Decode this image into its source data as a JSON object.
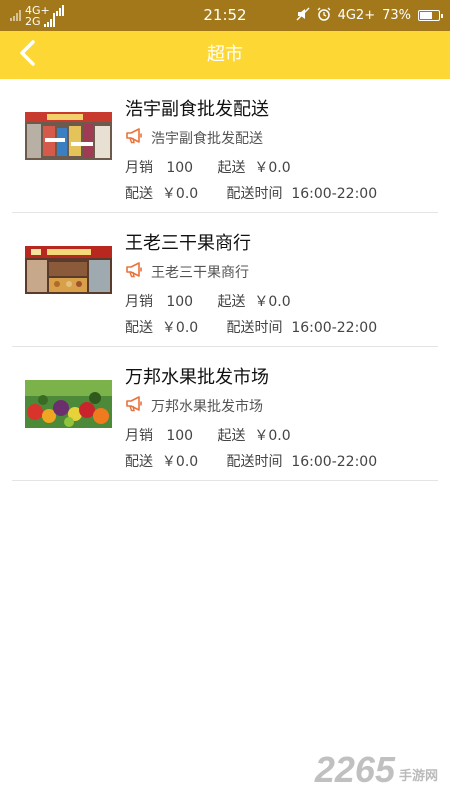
{
  "status_bar": {
    "network_1": "4G+",
    "network_2": "2G",
    "time": "21:52",
    "network_3": "4G2+",
    "battery_percent": "73%",
    "battery_level": 0.73
  },
  "header": {
    "title": "超市",
    "back_icon": "chevron-left-icon",
    "background": "#fdd835"
  },
  "shops": [
    {
      "name": "浩宇副食批发配送",
      "notice": "浩宇副食批发配送",
      "monthly_sales_label": "月销",
      "monthly_sales": "100",
      "min_order_label": "起送",
      "min_order": "￥0.0",
      "delivery_fee_label": "配送",
      "delivery_fee": "￥0.0",
      "delivery_time_label": "配送时间",
      "delivery_time": "16:00-22:00"
    },
    {
      "name": "王老三干果商行",
      "notice": "王老三干果商行",
      "monthly_sales_label": "月销",
      "monthly_sales": "100",
      "min_order_label": "起送",
      "min_order": "￥0.0",
      "delivery_fee_label": "配送",
      "delivery_fee": "￥0.0",
      "delivery_time_label": "配送时间",
      "delivery_time": "16:00-22:00"
    },
    {
      "name": "万邦水果批发市场",
      "notice": "万邦水果批发市场",
      "monthly_sales_label": "月销",
      "monthly_sales": "100",
      "min_order_label": "起送",
      "min_order": "￥0.0",
      "delivery_fee_label": "配送",
      "delivery_fee": "￥0.0",
      "delivery_time_label": "配送时间",
      "delivery_time": "16:00-22:00"
    }
  ],
  "notice_icon": "megaphone-icon",
  "watermark": {
    "number": "2265",
    "text": "手游网"
  }
}
